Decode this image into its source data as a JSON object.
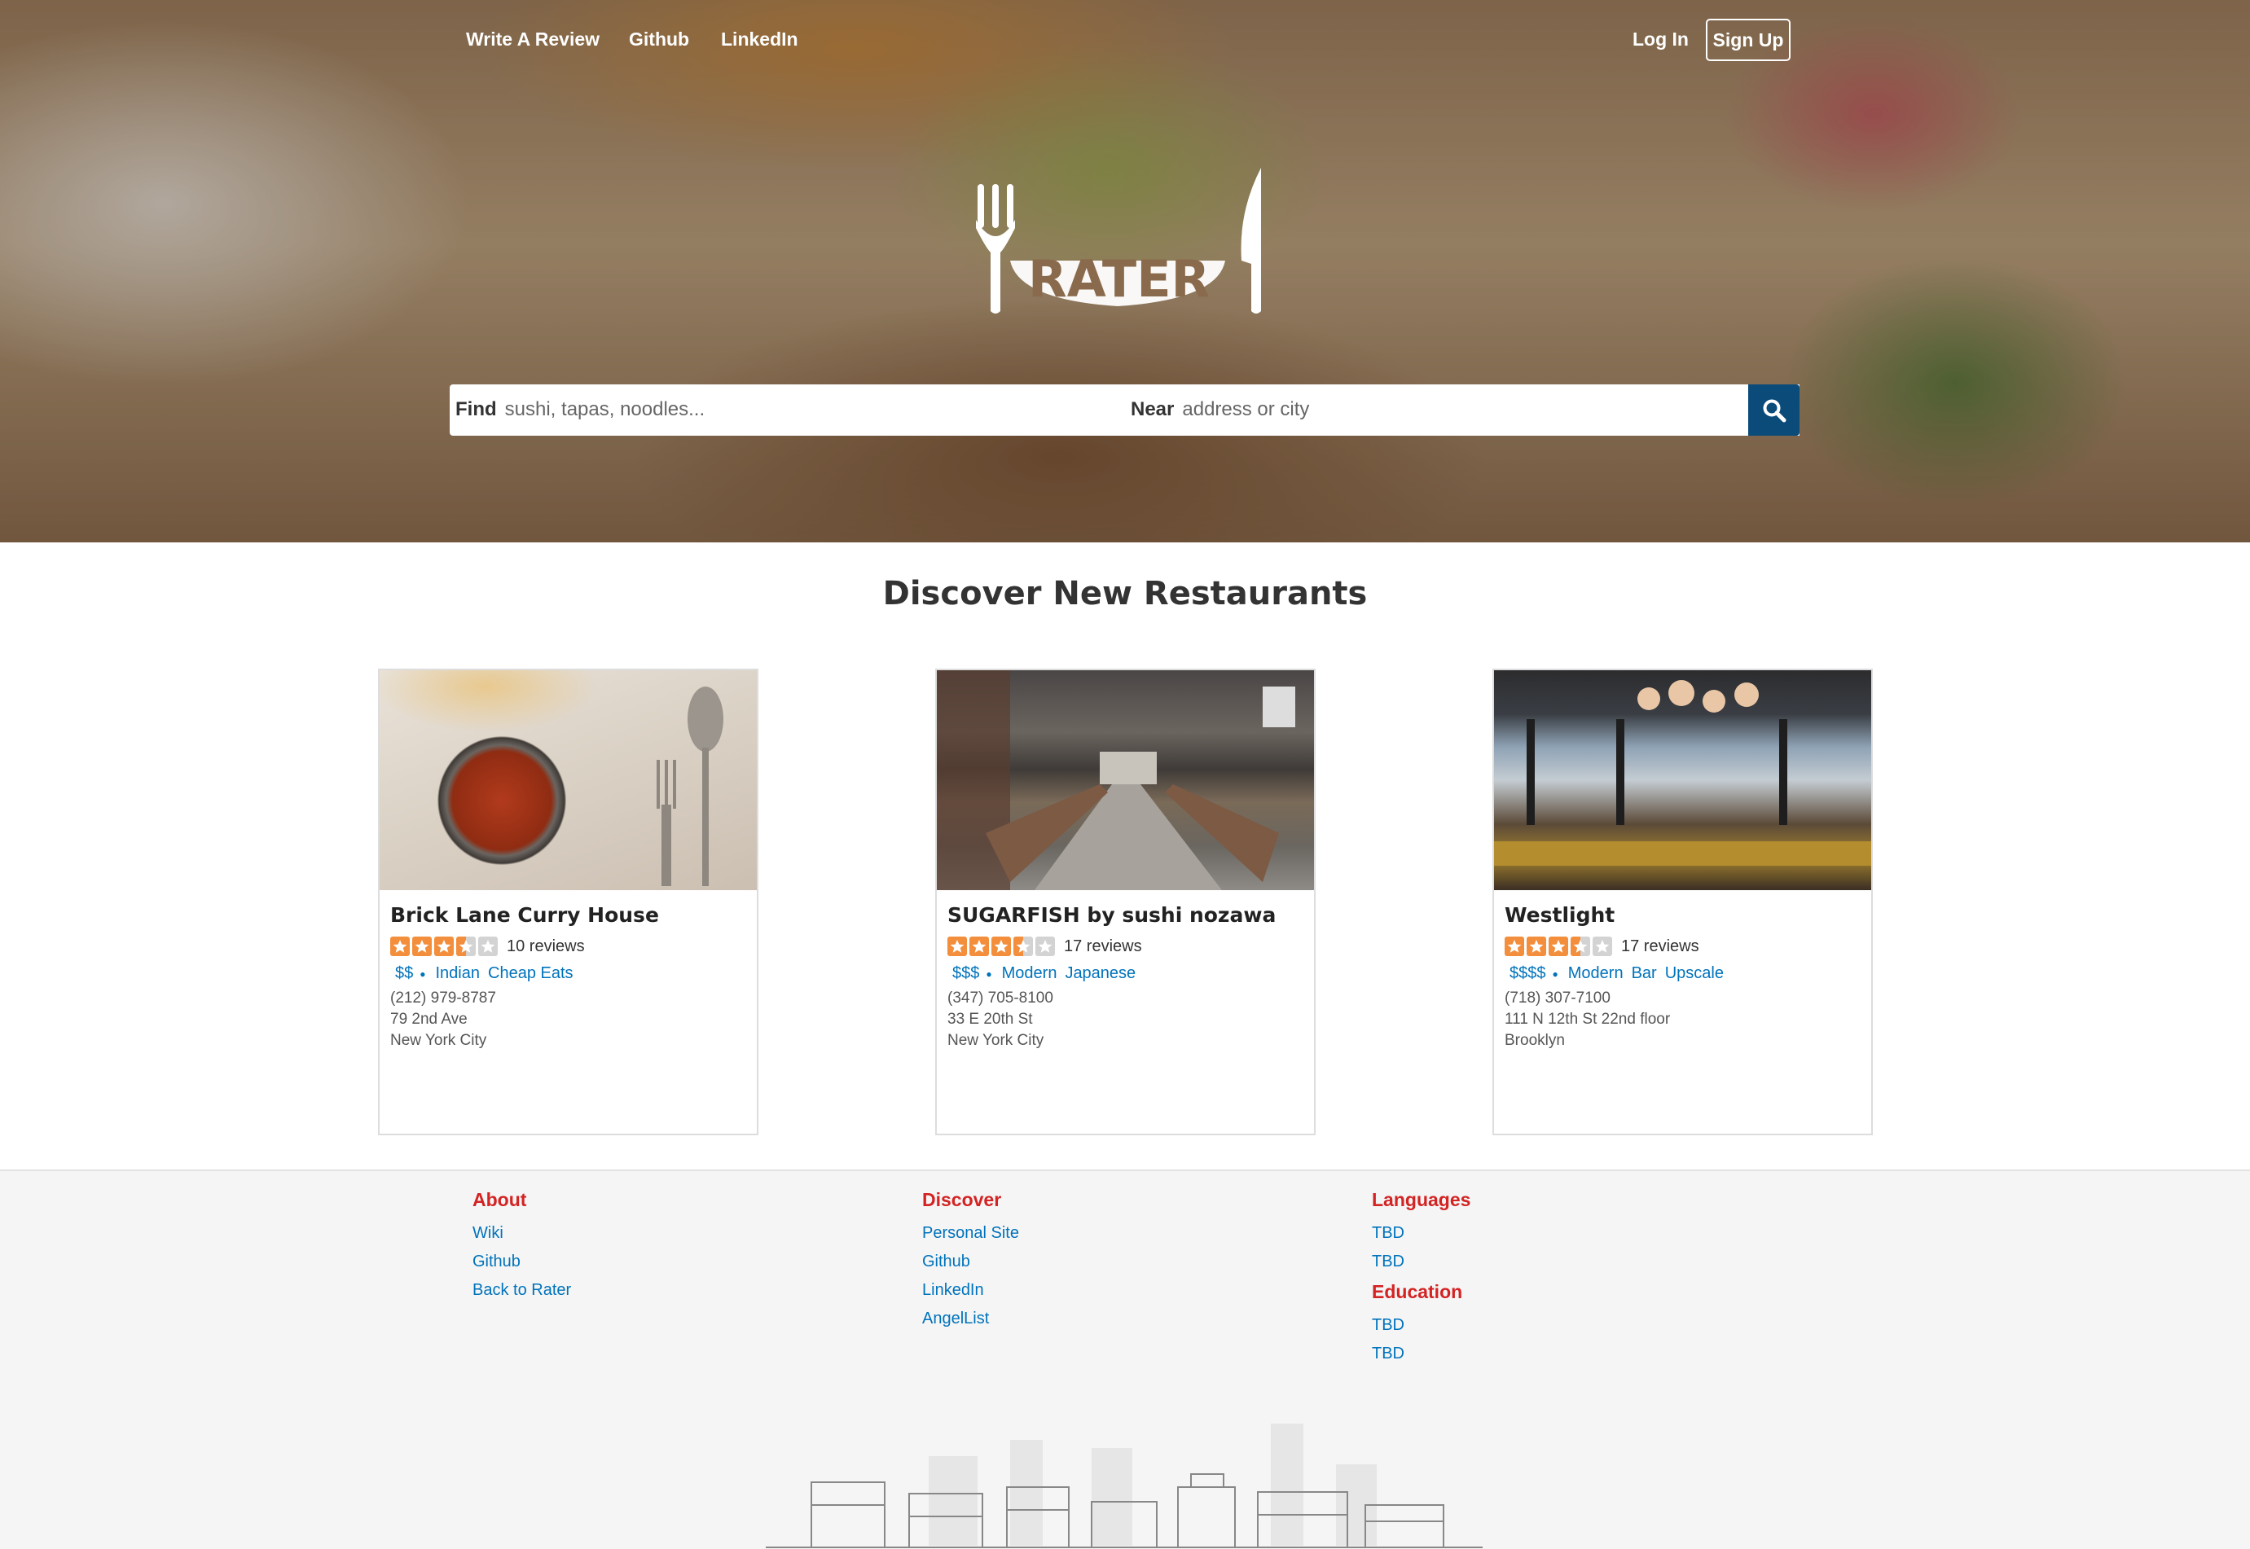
{
  "nav": {
    "links": [
      "Write A Review",
      "Github",
      "LinkedIn"
    ],
    "login": "Log In",
    "signup": "Sign Up"
  },
  "brand": {
    "logo_text": "RATER"
  },
  "search": {
    "find_label": "Find",
    "find_placeholder": "sushi, tapas, noodles...",
    "near_label": "Near",
    "near_placeholder": "address or city"
  },
  "discover": {
    "title": "Discover New Restaurants",
    "restaurants": [
      {
        "name": "Brick Lane Curry House",
        "rating": 3.5,
        "reviews": "10 reviews",
        "price": "$$",
        "categories": [
          "Indian",
          "Cheap Eats"
        ],
        "phone": "(212) 979-8787",
        "address": "79 2nd Ave",
        "city": "New York City"
      },
      {
        "name": "SUGARFISH by sushi nozawa",
        "rating": 3.5,
        "reviews": "17 reviews",
        "price": "$$$",
        "categories": [
          "Modern",
          "Japanese"
        ],
        "phone": "(347) 705-8100",
        "address": "33 E 20th St",
        "city": "New York City"
      },
      {
        "name": "Westlight",
        "rating": 3.5,
        "reviews": "17 reviews",
        "price": "$$$$",
        "categories": [
          "Modern",
          "Bar",
          "Upscale"
        ],
        "phone": "(718) 307-7100",
        "address": "111 N 12th St 22nd floor",
        "city": "Brooklyn"
      }
    ]
  },
  "footer": {
    "about": {
      "title": "About",
      "links": [
        "Wiki",
        "Github",
        "Back to Rater"
      ]
    },
    "discover": {
      "title": "Discover",
      "links": [
        "Personal Site",
        "Github",
        "LinkedIn",
        "AngelList"
      ]
    },
    "languages": {
      "title": "Languages",
      "links": [
        "TBD",
        "TBD"
      ]
    },
    "education": {
      "title": "Education",
      "links": [
        "TBD",
        "TBD"
      ]
    }
  },
  "colors": {
    "accent_red": "#d32323",
    "link_blue": "#0073bb",
    "search_button": "#0b4b7a",
    "star_orange": "#f38e3c"
  }
}
